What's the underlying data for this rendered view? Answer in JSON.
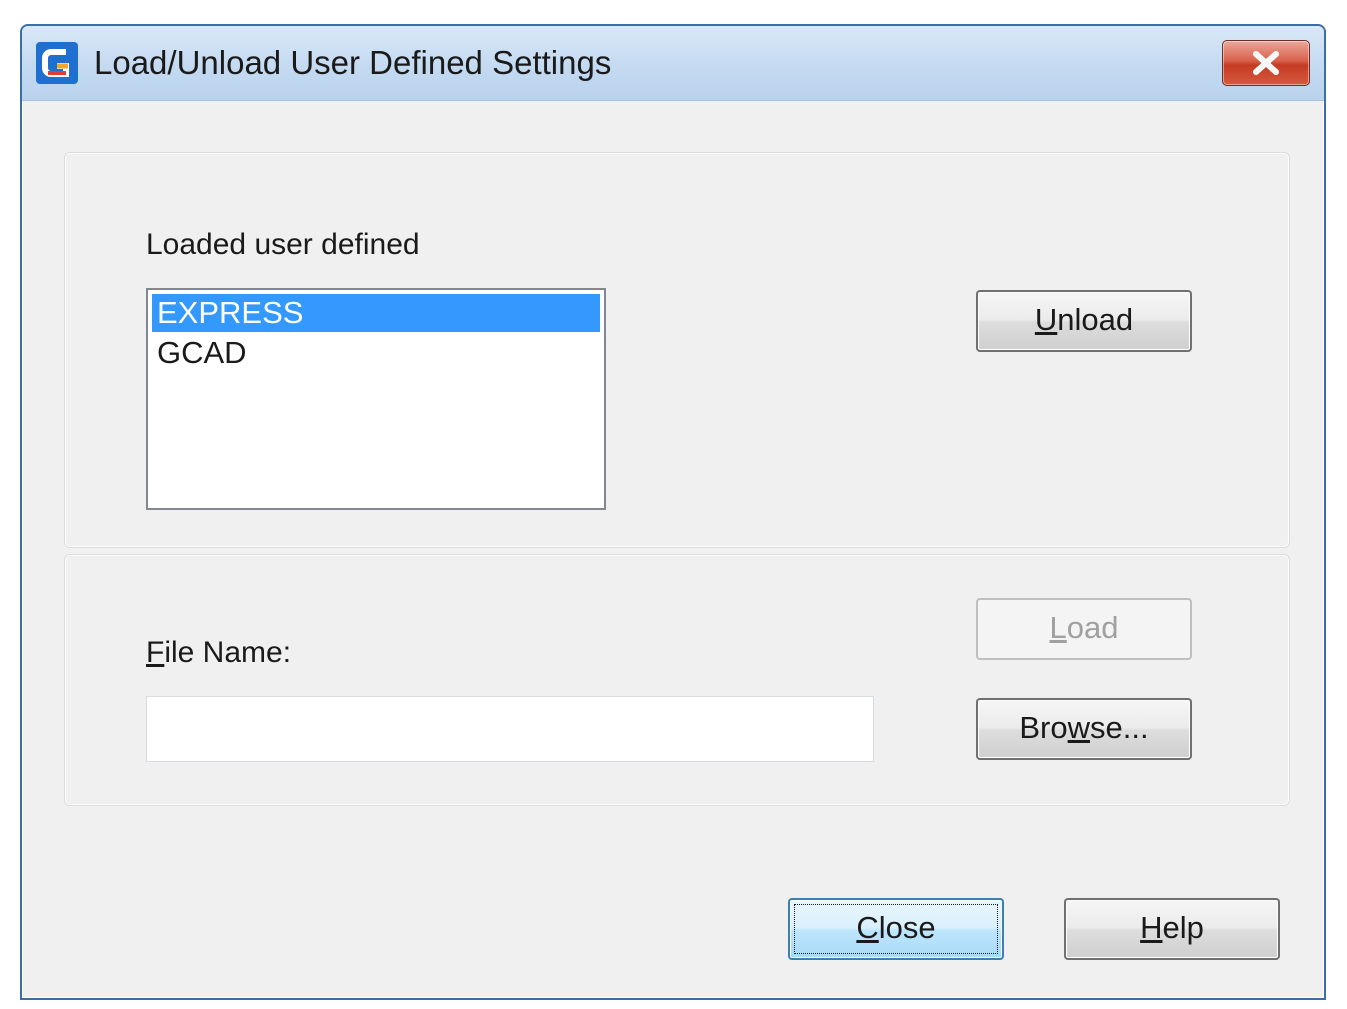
{
  "window": {
    "title": "Load/Unload User Defined Settings"
  },
  "icons": {
    "app": "gcad-logo-icon",
    "close": "close-x-icon"
  },
  "colors": {
    "selection": "#3399ff",
    "close_button": "#c43b22",
    "title_bar": "#c4daf1"
  },
  "loaded_section": {
    "label": "Loaded user defined",
    "items": [
      {
        "label": "EXPRESS",
        "selected": true
      },
      {
        "label": "GCAD",
        "selected": false
      }
    ],
    "unload_button": {
      "mnemonic": "U",
      "rest": "nload"
    }
  },
  "file_section": {
    "label_mnemonic": "F",
    "label_rest": "ile Name:",
    "file_name_value": "",
    "load_button": {
      "mnemonic": "L",
      "rest": "oad",
      "disabled": true
    },
    "browse_button": {
      "before": "Bro",
      "mnemonic": "w",
      "after": "se..."
    }
  },
  "footer": {
    "close_button": {
      "mnemonic": "C",
      "rest": "lose"
    },
    "help_button": {
      "mnemonic": "H",
      "rest": "elp"
    }
  }
}
